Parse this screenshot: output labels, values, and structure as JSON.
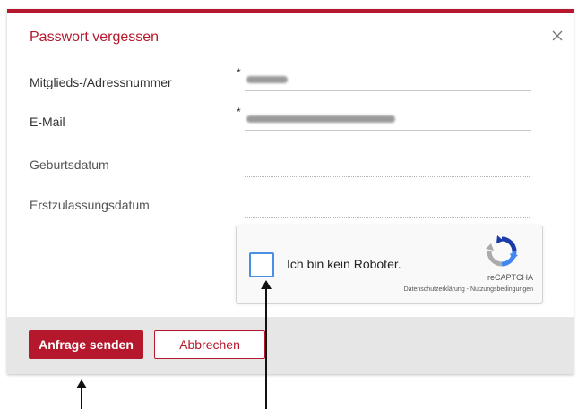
{
  "dialog": {
    "title": "Passwort vergessen",
    "close_icon": "close-icon"
  },
  "form": {
    "fields": [
      {
        "label": "Mitglieds-/Adressnummer",
        "required": true,
        "required_marker": "*",
        "value_redacted": true
      },
      {
        "label": "E-Mail",
        "required": true,
        "required_marker": "*",
        "value_redacted": true
      },
      {
        "label": "Geburtsdatum",
        "required": false,
        "value": ""
      },
      {
        "label": "Erstzulassungsdatum",
        "required": false,
        "value": ""
      }
    ]
  },
  "recaptcha": {
    "checkbox_label": "Ich bin kein Roboter.",
    "brand": "reCAPTCHA",
    "links": "Datenschutzerklärung - Nutzungsbedingungen",
    "checked": false
  },
  "footer": {
    "submit_label": "Anfrage senden",
    "cancel_label": "Abbrechen"
  },
  "colors": {
    "accent": "#b5182c",
    "footer_bg": "#e6e6e6",
    "checkbox_border": "#4a90e2"
  }
}
